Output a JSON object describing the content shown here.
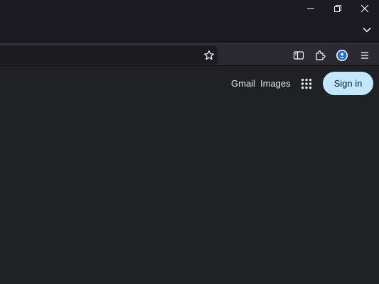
{
  "window": {
    "minimize_icon": "minimize-icon",
    "restore_icon": "restore-icon",
    "close_icon": "close-icon",
    "tabs_dropdown_icon": "chevron-down-icon"
  },
  "toolbar": {
    "bookmark_icon": "star-icon",
    "sidebar_icon": "sidebar-icon",
    "extensions_icon": "puzzle-icon",
    "account_icon": "profile-icon",
    "menu_icon": "hamburger-icon"
  },
  "header": {
    "gmail_label": "Gmail",
    "images_label": "Images",
    "apps_icon": "apps-grid-icon",
    "signin_label": "Sign in"
  },
  "colors": {
    "page_background": "#202124",
    "titlebar": "#1c1b22",
    "toolbar": "#2b2a33",
    "signin_background": "#c2e7ff",
    "signin_text": "#001d35",
    "link_text": "#e8eaed",
    "account_badge": "#1f6bde"
  }
}
